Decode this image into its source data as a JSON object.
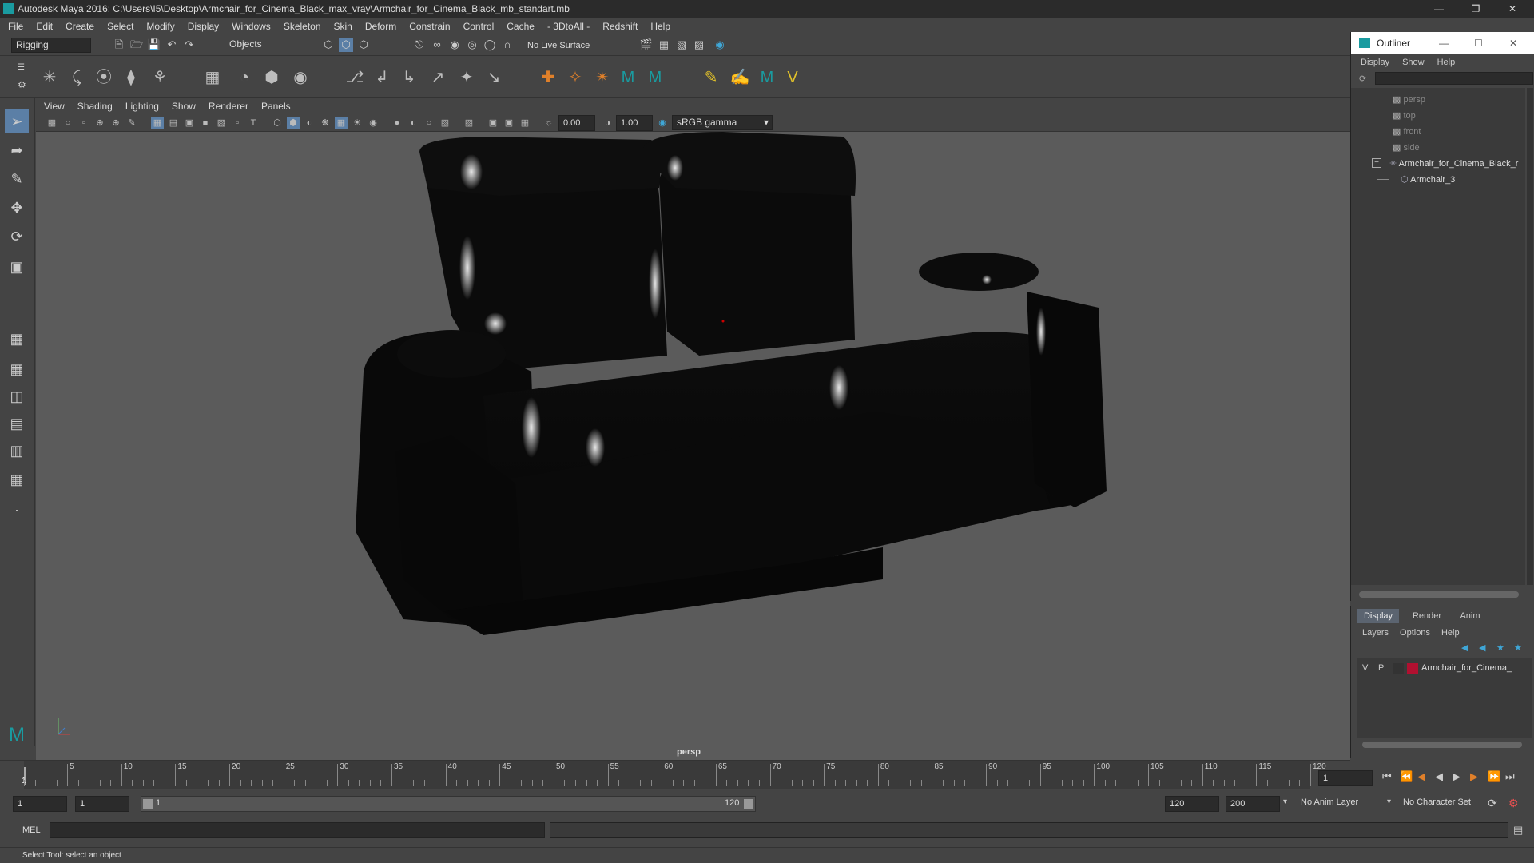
{
  "window": {
    "title": "Autodesk Maya 2016: C:\\Users\\I5\\Desktop\\Armchair_for_Cinema_Black_max_vray\\Armchair_for_Cinema_Black_mb_standart.mb"
  },
  "menubar": [
    "File",
    "Edit",
    "Create",
    "Select",
    "Modify",
    "Display",
    "Windows",
    "Skeleton",
    "Skin",
    "Deform",
    "Constrain",
    "Control",
    "Cache",
    "- 3DtoAll -",
    "Redshift",
    "Help"
  ],
  "statusline": {
    "mode": "Rigging",
    "select_mode": "Objects",
    "live_surface": "No Live Surface"
  },
  "viewport": {
    "menu": [
      "View",
      "Shading",
      "Lighting",
      "Show",
      "Renderer",
      "Panels"
    ],
    "field1": "0.00",
    "field2": "1.00",
    "colorspace": "sRGB gamma",
    "camera_label": "persp"
  },
  "outliner": {
    "title": "Outliner",
    "menu": [
      "Display",
      "Show",
      "Help"
    ],
    "items": [
      {
        "label": "persp"
      },
      {
        "label": "top"
      },
      {
        "label": "front"
      },
      {
        "label": "side"
      },
      {
        "label": "Armchair_for_Cinema_Black_r"
      },
      {
        "label": "Armchair_3"
      }
    ]
  },
  "layers": {
    "tabs": [
      "Display",
      "Render",
      "Anim"
    ],
    "menu": [
      "Layers",
      "Options",
      "Help"
    ],
    "row": {
      "v": "V",
      "p": "P",
      "name": "Armchair_for_Cinema_",
      "color": "#b01030"
    }
  },
  "timeline": {
    "ticks": [
      "5",
      "10",
      "15",
      "20",
      "25",
      "30",
      "35",
      "40",
      "45",
      "50",
      "55",
      "60",
      "65",
      "70",
      "75",
      "80",
      "85",
      "90",
      "95",
      "100",
      "105",
      "110",
      "115",
      "120"
    ],
    "start_marker": "1",
    "current_frame": "1"
  },
  "range": {
    "start": "1",
    "start2": "1",
    "slider_start": "1",
    "slider_end": "120",
    "end": "120",
    "end2": "200",
    "anim_layer": "No Anim Layer",
    "char_set": "No Character Set"
  },
  "mel": {
    "label": "MEL"
  },
  "help": {
    "text": "Select Tool: select an object"
  }
}
